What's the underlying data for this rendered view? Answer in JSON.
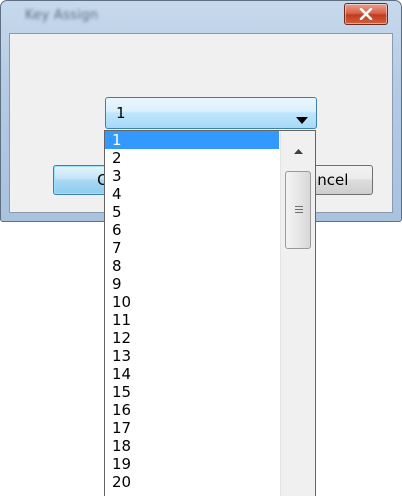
{
  "window": {
    "title": "Key Assign"
  },
  "buttons": {
    "ok_label": "OK",
    "cancel_label": "Cancel"
  },
  "combo": {
    "value": "1"
  },
  "dropdown": {
    "options": [
      "1",
      "2",
      "3",
      "4",
      "5",
      "6",
      "7",
      "8",
      "9",
      "10",
      "11",
      "12",
      "13",
      "14",
      "15",
      "16",
      "17",
      "18",
      "19",
      "20"
    ],
    "selected_index": 0
  },
  "icons": {
    "close": "close-icon",
    "arrow": "chevron-down-icon",
    "scroll_up": "scroll-up-arrow-icon",
    "grip": "grip-icon"
  },
  "colors": {
    "selection": "#3399ff",
    "close_button": "#c23c1f",
    "title_bar": "#b4cbe4"
  }
}
